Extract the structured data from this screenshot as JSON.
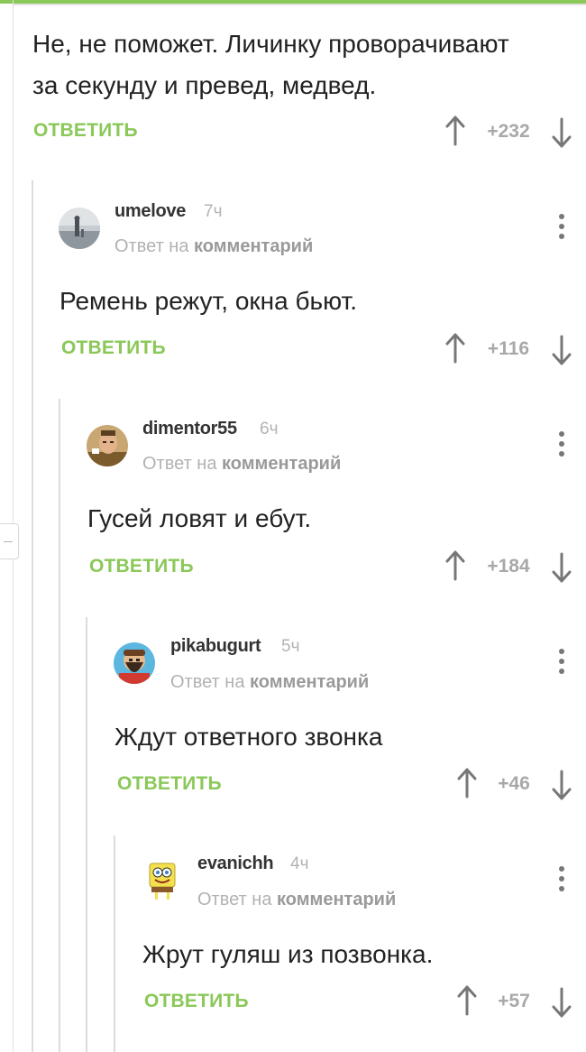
{
  "colors": {
    "accent": "#8ac858",
    "text": "#222222",
    "muted": "#b2b2b2",
    "icon": "#777777"
  },
  "root_comment": {
    "text_line1": "Не, не поможет. Личинку проворачивают",
    "text_line2": "за секунду и превед, медвед.",
    "reply_label": "ОТВЕТИТЬ",
    "score": "+232"
  },
  "replies": [
    {
      "author": "umelove",
      "time": "7ч",
      "reply_prefix": "Ответ на",
      "reply_target": "комментарий",
      "text": "Ремень режут, окна бьют.",
      "reply_label": "ОТВЕТИТЬ",
      "score": "+116",
      "avatar_icon": "avatar-photo-sea"
    },
    {
      "author": "dimentor55",
      "time": "6ч",
      "reply_prefix": "Ответ на",
      "reply_target": "комментарий",
      "text": "Гусей ловят и ебут.",
      "reply_label": "ОТВЕТИТЬ",
      "score": "+184",
      "avatar_icon": "avatar-photo-man"
    },
    {
      "author": "pikabugurt",
      "time": "5ч",
      "reply_prefix": "Ответ на",
      "reply_target": "комментарий",
      "text": "Ждут ответного звонка",
      "reply_label": "ОТВЕТИТЬ",
      "score": "+46",
      "avatar_icon": "avatar-bearded-man"
    },
    {
      "author": "evanichh",
      "time": "4ч",
      "reply_prefix": "Ответ на",
      "reply_target": "комментарий",
      "text": "Жрут гуляш из позвонка.",
      "reply_label": "ОТВЕТИТЬ",
      "score": "+57",
      "avatar_icon": "avatar-sponge"
    }
  ]
}
